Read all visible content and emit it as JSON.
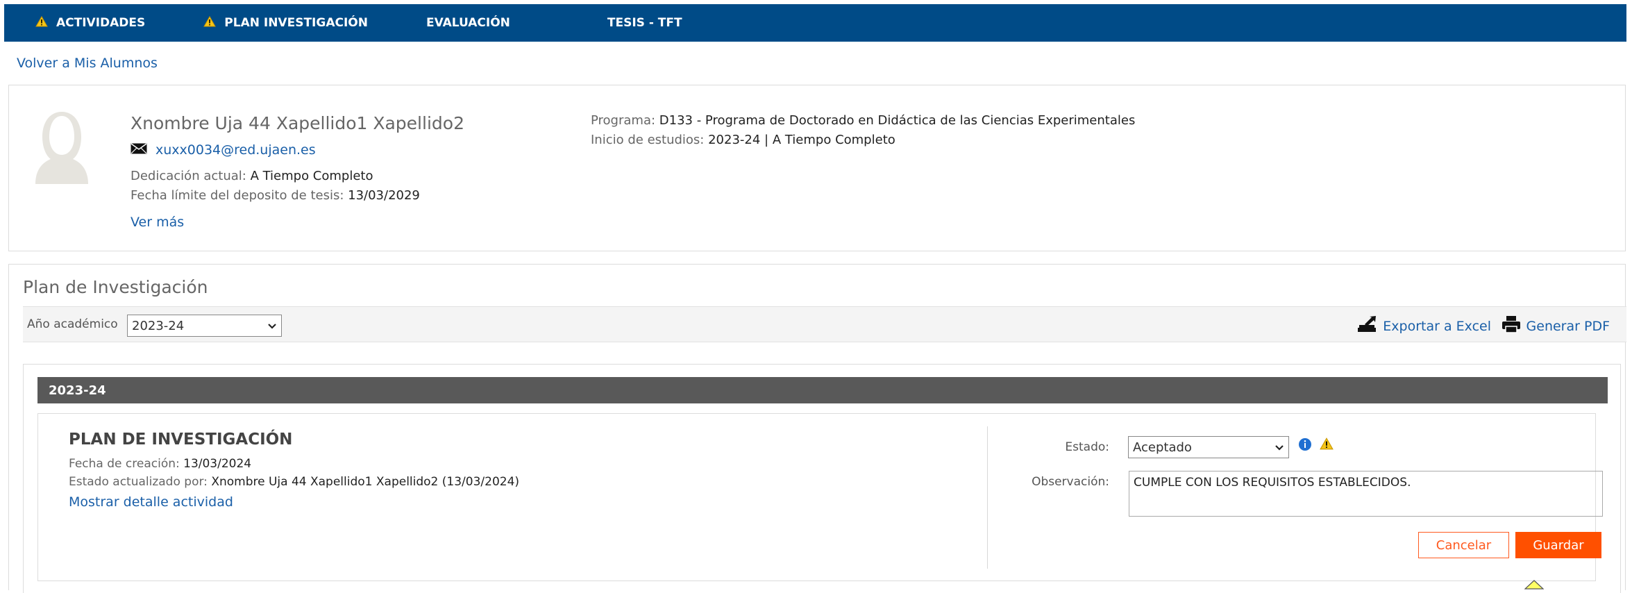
{
  "nav": {
    "items": [
      {
        "label": "ACTIVIDADES",
        "warning": true
      },
      {
        "label": "PLAN INVESTIGACIÓN",
        "warning": true
      },
      {
        "label": "EVALUACIÓN",
        "warning": false
      },
      {
        "label": "TESIS - TFT",
        "warning": false
      }
    ]
  },
  "back_link": "Volver a Mis Alumnos",
  "student": {
    "name": "Xnombre Uja 44 Xapellido1 Xapellido2",
    "email": "xuxx0034@red.ujaen.es",
    "dedicacion_label": "Dedicación actual:",
    "dedicacion_value": "A Tiempo Completo",
    "fecha_limite_label": "Fecha límite del deposito de tesis:",
    "fecha_limite_value": "13/03/2029",
    "ver_mas": "Ver más",
    "programa_label": "Programa:",
    "programa_value": "D133 - Programa de Doctorado en Didáctica de las Ciencias Experimentales",
    "inicio_label": "Inicio de estudios:",
    "inicio_value": "2023-24 | A Tiempo Completo"
  },
  "plan": {
    "title": "Plan de Investigación",
    "year_label": "Año académico",
    "year_selected": "2023-24",
    "export_label": "Exportar a Excel",
    "pdf_label": "Generar PDF",
    "year_bar": "2023-24",
    "card": {
      "title": "PLAN DE INVESTIGACIÓN",
      "fecha_label": "Fecha de creación:",
      "fecha_value": "13/03/2024",
      "estado_por_label": "Estado actualizado por:",
      "estado_por_value": "Xnombre Uja 44 Xapellido1 Xapellido2 (13/03/2024)",
      "detalle_link": "Mostrar detalle actividad",
      "estado_label": "Estado:",
      "estado_value": "Aceptado",
      "observacion_label": "Observación:",
      "observacion_value": "CUMPLE CON LOS REQUISITOS ESTABLECIDOS.",
      "cancel_label": "Cancelar",
      "save_label": "Guardar"
    }
  },
  "colors": {
    "nav_bg": "#004b87",
    "accent": "#ff5000",
    "link": "#1a5fa8",
    "year_bar": "#595959"
  }
}
